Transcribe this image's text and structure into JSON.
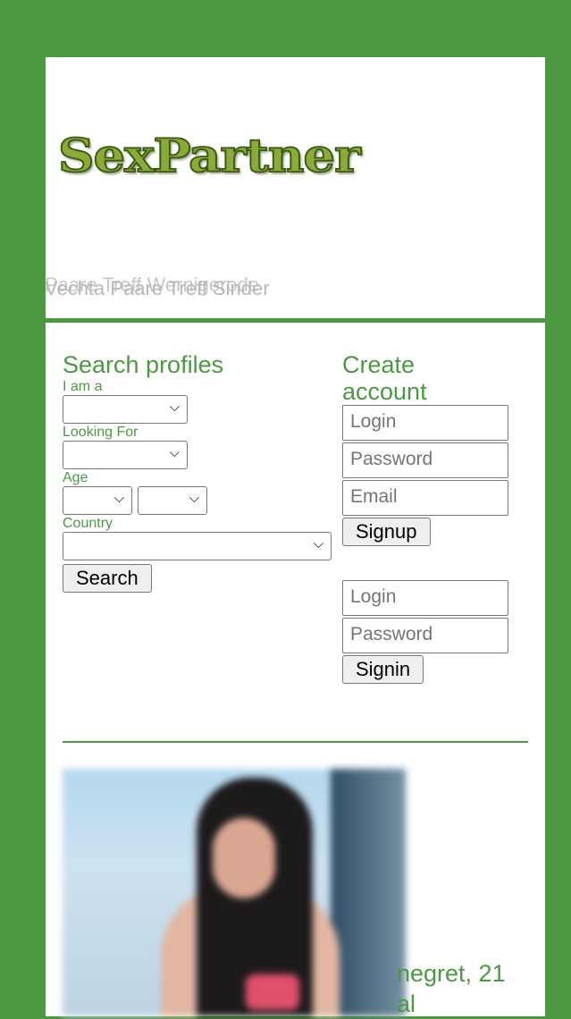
{
  "header": {
    "logo_text": "SexPartner",
    "overlap_text_a": "Paare Treff Wernigerode",
    "overlap_text_b": "Vechta Paare Treff Sinder"
  },
  "search": {
    "title": "Search profiles",
    "i_am_label": "I am a",
    "i_am_value": "",
    "looking_for_label": "Looking For",
    "looking_for_value": "",
    "age_label": "Age",
    "age_from_value": "",
    "age_to_value": "",
    "country_label": "Country",
    "country_value": "",
    "search_button": "Search"
  },
  "account": {
    "title_line1": "Create",
    "title_line2": "account",
    "login_placeholder": "Login",
    "password_placeholder": "Password",
    "email_placeholder": "Email",
    "signup_button": "Signup",
    "signin_login_placeholder": "Login",
    "signin_password_placeholder": "Password",
    "signin_button": "Signin"
  },
  "profile": {
    "caption_line1": "negret, 21",
    "caption_line2": "al"
  },
  "colors": {
    "brand_green": "#4b9a42",
    "logo_green": "#8caa3a"
  },
  "icons": {
    "select_chevron": "chevron-down-icon"
  }
}
